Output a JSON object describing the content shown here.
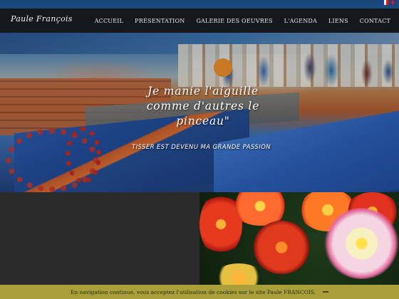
{
  "site": {
    "brand": "Paule François"
  },
  "nav": {
    "items": [
      {
        "label": "ACCUEIL"
      },
      {
        "label": "PRÉSENTATION"
      },
      {
        "label": "GALERIE DES OEUVRES"
      },
      {
        "label": "L'AGENDA"
      },
      {
        "label": "LIENS"
      },
      {
        "label": "CONTACT"
      }
    ],
    "languages": [
      "fr-flag-icon",
      "en-flag-icon"
    ]
  },
  "hero": {
    "quote_lines": [
      "Je manie l'aiguille",
      "comme d'autres le",
      "pinceau\""
    ],
    "tagline": "TISSER EST DEVENU MA GRANDE PASSION"
  },
  "cookie_bar": {
    "text": "En navigation continue, vous acceptez l'utilisation de cookies sur le site Paule FRANCOIS.",
    "dismiss_icon": "dash-icon",
    "bar_color": "#a9a03a"
  }
}
